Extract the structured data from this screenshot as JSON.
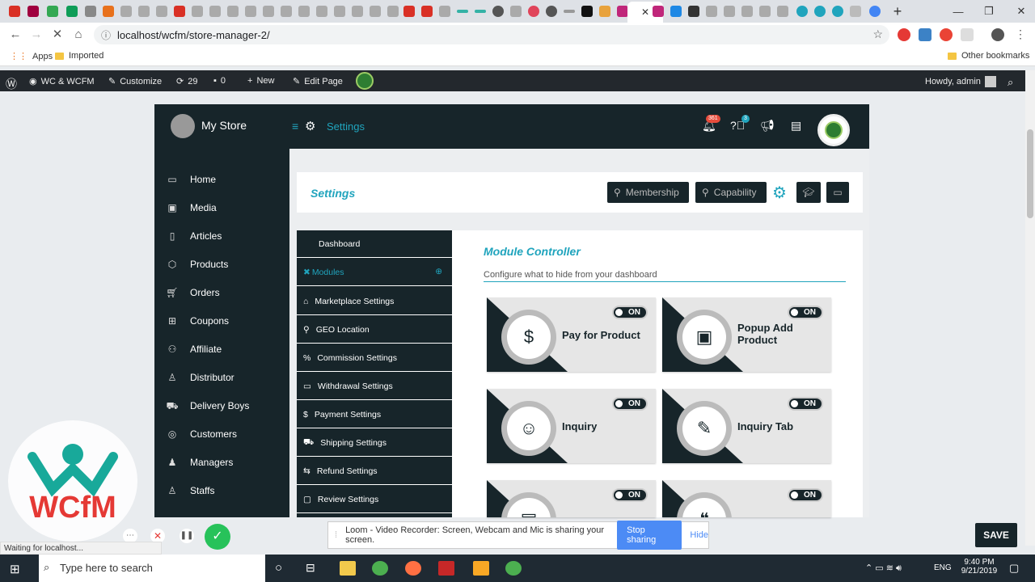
{
  "browser": {
    "url": "localhost/wcfm/store-manager-2/",
    "bookmarks": {
      "apps": "Apps",
      "imported": "Imported",
      "other": "Other bookmarks"
    }
  },
  "adminbar": {
    "site": "WC & WCFM",
    "customize": "Customize",
    "updates": "29",
    "comments": "0",
    "new": "New",
    "edit_page": "Edit Page",
    "howdy": "Howdy, admin"
  },
  "header": {
    "store_name": "My Store",
    "section": "Settings",
    "notifications_count": "361",
    "help_count": "3"
  },
  "sidebar": {
    "items": [
      {
        "label": "Home",
        "icon": "monitor-icon"
      },
      {
        "label": "Media",
        "icon": "image-icon"
      },
      {
        "label": "Articles",
        "icon": "document-icon"
      },
      {
        "label": "Products",
        "icon": "box-icon"
      },
      {
        "label": "Orders",
        "icon": "cart-icon"
      },
      {
        "label": "Coupons",
        "icon": "gift-icon"
      },
      {
        "label": "Affiliate",
        "icon": "users-icon"
      },
      {
        "label": "Distributor",
        "icon": "user-icon"
      },
      {
        "label": "Delivery Boys",
        "icon": "truck-icon"
      },
      {
        "label": "Customers",
        "icon": "user-circle-icon"
      },
      {
        "label": "Managers",
        "icon": "user-tie-icon"
      },
      {
        "label": "Staffs",
        "icon": "user-icon"
      }
    ]
  },
  "settings": {
    "title": "Settings",
    "buttons": {
      "membership": "Membership",
      "capability": "Capability"
    }
  },
  "leftmenu": {
    "items": [
      {
        "label": "Dashboard",
        "icon": ""
      },
      {
        "label": "Modules",
        "icon": "modules-icon"
      },
      {
        "label": "Marketplace Settings",
        "icon": "home-icon"
      },
      {
        "label": "GEO Location",
        "icon": "location-icon"
      },
      {
        "label": "Commission Settings",
        "icon": "percent-icon"
      },
      {
        "label": "Withdrawal Settings",
        "icon": "card-icon"
      },
      {
        "label": "Payment Settings",
        "icon": "dollar-icon"
      },
      {
        "label": "Shipping Settings",
        "icon": "truck-icon"
      },
      {
        "label": "Refund Settings",
        "icon": "refund-icon"
      },
      {
        "label": "Review Settings",
        "icon": "comment-icon"
      }
    ]
  },
  "module": {
    "title": "Module Controller",
    "subtitle": "Configure what to hide from your dashboard",
    "cards": [
      {
        "title": "Pay for Product",
        "state": "ON",
        "icon": "hand-money-icon"
      },
      {
        "title": "Popup Add Product",
        "state": "ON",
        "icon": "popup-icon"
      },
      {
        "title": "Inquiry",
        "state": "ON",
        "icon": "inquiry-icon"
      },
      {
        "title": "Inquiry Tab",
        "state": "ON",
        "icon": "edit-icon"
      },
      {
        "title": "",
        "state": "ON",
        "icon": "catalog-icon"
      },
      {
        "title": "",
        "state": "ON",
        "icon": "article-icon"
      }
    ]
  },
  "save_label": "SAVE",
  "status": "Waiting for localhost...",
  "loom": {
    "message": "Loom - Video Recorder: Screen, Webcam and Mic is sharing your screen.",
    "stop": "Stop sharing",
    "hide": "Hide"
  },
  "taskbar": {
    "search": "Type here to search",
    "lang": "ENG",
    "time": "9:40 PM",
    "date": "9/21/2019"
  },
  "colors": {
    "dark": "#17252a",
    "accent": "#20a4bd",
    "badge": "#e74c3c"
  }
}
